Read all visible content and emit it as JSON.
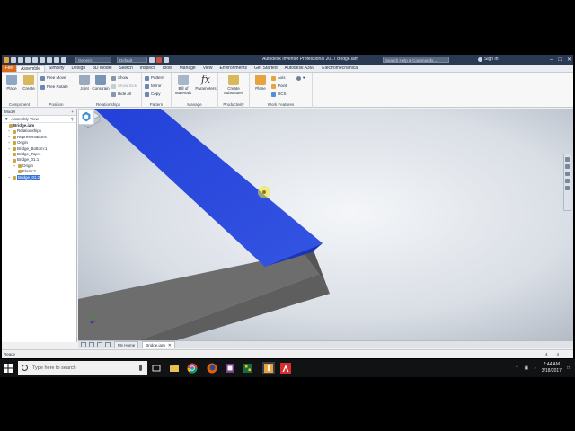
{
  "title_bar": {
    "app_title": "Autodesk Inventor Professional 2017   Bridge.iam",
    "material_combo": "Generic",
    "appearance_combo": "Default",
    "search_placeholder": "Search Help & Commands...",
    "sign_in": "Sign In"
  },
  "menu_tabs": [
    "File",
    "Assemble",
    "Simplify",
    "Design",
    "3D Model",
    "Sketch",
    "Inspect",
    "Tools",
    "Manage",
    "View",
    "Environments",
    "Get Started",
    "Autodesk A360",
    "Electromechanical"
  ],
  "active_tab": "Assemble",
  "ribbon": {
    "component": {
      "label": "Component",
      "place": "Place",
      "create": "Create"
    },
    "position": {
      "label": "Position",
      "free_move": "Free Move",
      "free_rotate": "Free Rotate"
    },
    "relationships": {
      "label": "Relationships",
      "joint": "Joint",
      "constrain": "Constrain",
      "show": "Show",
      "show_sick": "Show Sick",
      "hide_all": "Hide All"
    },
    "pattern": {
      "label": "Pattern",
      "pattern": "Pattern",
      "mirror": "Mirror",
      "copy": "Copy"
    },
    "manage": {
      "label": "Manage",
      "bom_line1": "Bill of",
      "bom_line2": "Materials",
      "parameters": "Parameters"
    },
    "productivity": {
      "label": "Productivity",
      "create_sub_line1": "Create",
      "create_sub_line2": "Substitutes"
    },
    "work_features": {
      "label": "Work Features",
      "plane": "Plane",
      "axis": "Axis",
      "point": "Point",
      "ucs": "UCS"
    }
  },
  "browser": {
    "header": "Model",
    "view_label": "Assembly View",
    "tree": [
      {
        "label": "Bridge.iam",
        "depth": 0,
        "bold": true,
        "expander": ""
      },
      {
        "label": "Relationships",
        "depth": 1,
        "expander": "+"
      },
      {
        "label": "Representations",
        "depth": 1,
        "expander": "+"
      },
      {
        "label": "Origin",
        "depth": 1,
        "expander": "+"
      },
      {
        "label": "Bridge_Bottom:1",
        "depth": 1,
        "expander": "+"
      },
      {
        "label": "Bridge_Top:1",
        "depth": 1,
        "expander": "+"
      },
      {
        "label": "Bridge_01:1",
        "depth": 1,
        "expander": "-"
      },
      {
        "label": "Origin",
        "depth": 2,
        "expander": "+"
      },
      {
        "label": "Flush:2",
        "depth": 2,
        "expander": ""
      },
      {
        "label": "Bridge_01:2",
        "depth": 1,
        "expander": "+",
        "selected": true
      }
    ]
  },
  "doc_tabs": {
    "home": "My Home",
    "active": "Bridge.iam"
  },
  "status": {
    "text": "Ready",
    "count_a": "4",
    "count_b": "4"
  },
  "taskbar": {
    "search_placeholder": "Type here to search",
    "time": "7:44 AM",
    "date": "3/18/2017"
  },
  "colors": {
    "selected_part": "#2f49d8",
    "part_gray": "#6b6b6b",
    "ribbon_file_tab": "#d76e1f",
    "title_bar": "#2a3a52"
  }
}
